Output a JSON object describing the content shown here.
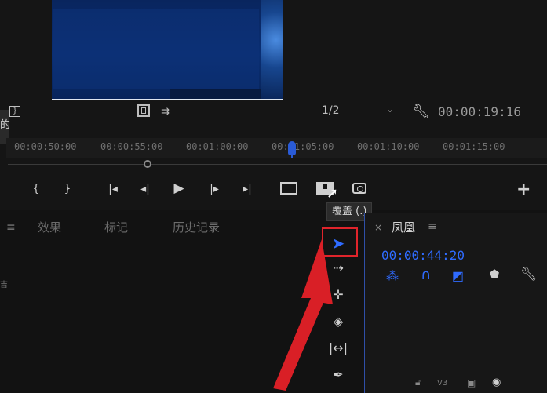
{
  "monitor": {
    "page_indicator": "1/2",
    "timecode": "00:00:19:16",
    "ruler_ticks": [
      "00:00:50:00",
      "00:00:55:00",
      "00:01:00:00",
      "00:01:05:00",
      "00:01:10:00",
      "00:01:15:00"
    ]
  },
  "tooltip": {
    "text": "覆盖 (.)"
  },
  "panels": {
    "tabs": [
      "效果",
      "标记",
      "历史记录"
    ],
    "left_edge_chars": [
      "的",
      "吉"
    ]
  },
  "timeline": {
    "title": "凤凰",
    "timecode": "00:00:44:20",
    "track_label": "V3"
  },
  "colors": {
    "accent_blue": "#2f6bff",
    "highlight_red": "#e0242b"
  }
}
